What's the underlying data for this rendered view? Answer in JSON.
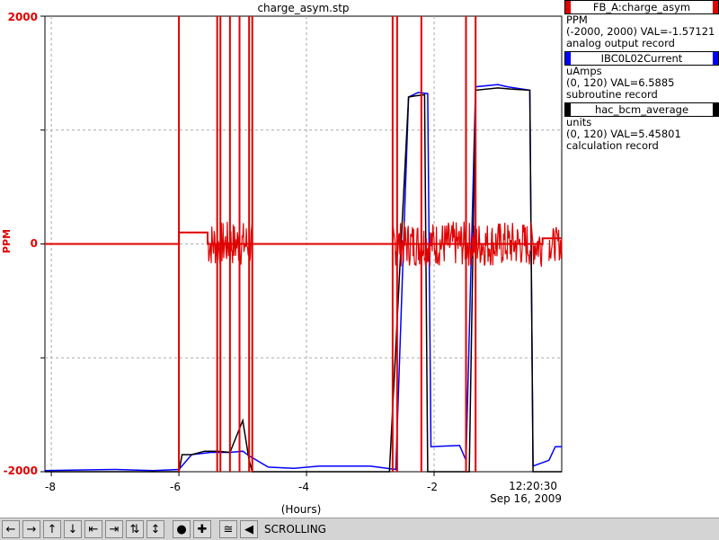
{
  "title": "charge_asym.stp",
  "chart_data": {
    "type": "line",
    "title": "charge_asym.stp",
    "xlabel": "(Hours)",
    "ylabel": "PPM",
    "xlim": [
      -8.1,
      0
    ],
    "ylim": [
      -2000,
      2000
    ],
    "x_ticks": [
      "-8",
      "-6",
      "-4",
      "-2"
    ],
    "x_tick_values": [
      -8,
      -6,
      -4,
      -2
    ],
    "y_ticks": [
      "2000",
      "0",
      "-2000"
    ],
    "time_label": "12:20:30",
    "date_label": "Sep 16, 2009",
    "grid": true,
    "series": [
      {
        "name": "FB_A:charge_asym",
        "color": "#e00000",
        "baseline": [
          [
            -8.1,
            0
          ],
          [
            -6.0,
            0
          ],
          [
            -6.0,
            100
          ],
          [
            -5.55,
            100
          ],
          [
            -5.55,
            0
          ],
          [
            -4.85,
            0
          ],
          [
            -2.7,
            0
          ],
          [
            -2.65,
            0
          ],
          [
            -0.3,
            0
          ],
          [
            -0.3,
            50
          ],
          [
            0,
            50
          ]
        ],
        "noise_regions": [
          [
            -5.55,
            -4.85,
            200
          ],
          [
            -2.65,
            -0.3,
            200
          ],
          [
            -0.2,
            0,
            150
          ]
        ],
        "spikes": [
          -6.0,
          -5.4,
          -5.35,
          -5.2,
          -5.05,
          -4.9,
          -4.85,
          -2.65,
          -2.58,
          -2.2,
          -1.5,
          -1.35
        ]
      },
      {
        "name": "IBC0L02Current",
        "color": "#0000ff",
        "points": [
          [
            -8.1,
            -1990
          ],
          [
            -7.6,
            -1985
          ],
          [
            -7.0,
            -1980
          ],
          [
            -6.4,
            -1990
          ],
          [
            -6.0,
            -1980
          ],
          [
            -5.8,
            -1850
          ],
          [
            -5.5,
            -1830
          ],
          [
            -5.2,
            -1830
          ],
          [
            -5.0,
            -1820
          ],
          [
            -4.9,
            -1860
          ],
          [
            -4.6,
            -1960
          ],
          [
            -4.2,
            -1970
          ],
          [
            -3.8,
            -1950
          ],
          [
            -3.4,
            -1950
          ],
          [
            -3.0,
            -1950
          ],
          [
            -2.6,
            -1980
          ],
          [
            -2.4,
            1290
          ],
          [
            -2.25,
            1330
          ],
          [
            -2.1,
            1320
          ],
          [
            -2.05,
            -1780
          ],
          [
            -1.6,
            -1770
          ],
          [
            -1.5,
            -1900
          ],
          [
            -1.35,
            1380
          ],
          [
            -1.0,
            1400
          ],
          [
            -0.85,
            1380
          ],
          [
            -0.5,
            1350
          ],
          [
            -0.45,
            -1950
          ],
          [
            -0.2,
            -1900
          ],
          [
            -0.1,
            -1780
          ],
          [
            0,
            -1780
          ]
        ]
      },
      {
        "name": "hac_bcm_average",
        "color": "#000000",
        "points": [
          [
            -8.1,
            -2000
          ],
          [
            -6.0,
            -2000
          ],
          [
            -5.95,
            -1850
          ],
          [
            -5.8,
            -1850
          ],
          [
            -5.6,
            -1820
          ],
          [
            -5.4,
            -1820
          ],
          [
            -5.2,
            -1830
          ],
          [
            -5.0,
            -1550
          ],
          [
            -4.9,
            -1900
          ],
          [
            -4.85,
            -2000
          ],
          [
            -2.7,
            -2000
          ],
          [
            -2.4,
            1290
          ],
          [
            -2.3,
            1300
          ],
          [
            -2.15,
            1310
          ],
          [
            -2.1,
            -2000
          ],
          [
            -1.45,
            -2000
          ],
          [
            -1.35,
            1350
          ],
          [
            -1.0,
            1370
          ],
          [
            -0.8,
            1360
          ],
          [
            -0.5,
            1350
          ],
          [
            -0.45,
            -2000
          ],
          [
            0,
            -2000
          ]
        ]
      }
    ]
  },
  "legend": [
    {
      "name": "FB_A:charge_asym",
      "color": "#e00000",
      "line1": "PPM",
      "line2": "(-2000, 2000) VAL=-1.57121",
      "line3": "analog output record"
    },
    {
      "name": "IBC0L02Current",
      "color": "#0000ff",
      "line1": "uAmps",
      "line2": "(0, 120) VAL=6.5885",
      "line3": "subroutine record"
    },
    {
      "name": "hac_bcm_average",
      "color": "#000000",
      "line1": "units",
      "line2": "(0, 120) VAL=5.45801",
      "line3": "calculation record"
    }
  ],
  "toolbar": {
    "buttons": [
      "arrow-left-icon",
      "arrow-right-icon",
      "arrow-up-icon",
      "arrow-down-icon",
      "expand-horizontal-icon",
      "compress-horizontal-icon",
      "expand-vertical-icon",
      "compress-vertical-icon",
      "circle-icon",
      "plus-icon",
      "autoscale-icon",
      "step-back-icon"
    ],
    "glyphs": [
      "←",
      "→",
      "↑",
      "↓",
      "⇤",
      "⇥",
      "⇅",
      "↕",
      "●",
      "✚",
      "≅",
      "◀"
    ],
    "status": "SCROLLING"
  }
}
